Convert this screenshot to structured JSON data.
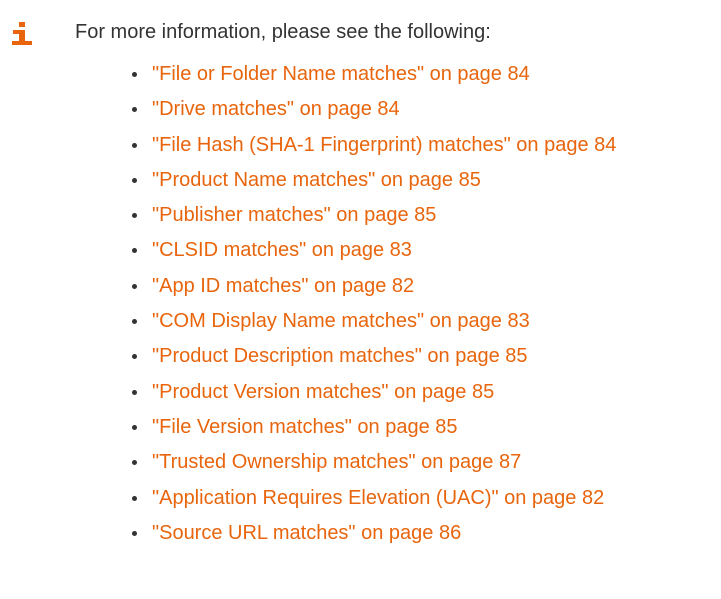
{
  "note": {
    "icon": "info-icon",
    "accent_color": "#e8650d",
    "intro_text": "For more information, please see the following:",
    "links": [
      {
        "label": "\"File or Folder Name matches\" on page 84"
      },
      {
        "label": "\"Drive matches\" on page 84"
      },
      {
        "label": "\"File Hash (SHA-1 Fingerprint) matches\" on page 84"
      },
      {
        "label": "\"Product Name matches\" on page 85"
      },
      {
        "label": "\"Publisher matches\" on page 85"
      },
      {
        "label": "\"CLSID matches\" on page 83"
      },
      {
        "label": "\"App ID matches\" on page 82"
      },
      {
        "label": "\"COM Display Name matches\" on page 83"
      },
      {
        "label": "\"Product Description matches\" on page 85"
      },
      {
        "label": "\"Product Version matches\" on page 85"
      },
      {
        "label": "\"File Version matches\" on page 85"
      },
      {
        "label": "\"Trusted Ownership matches\" on page 87"
      },
      {
        "label": "\"Application Requires Elevation (UAC)\" on page 82"
      },
      {
        "label": "\"Source URL matches\" on page 86"
      }
    ]
  }
}
